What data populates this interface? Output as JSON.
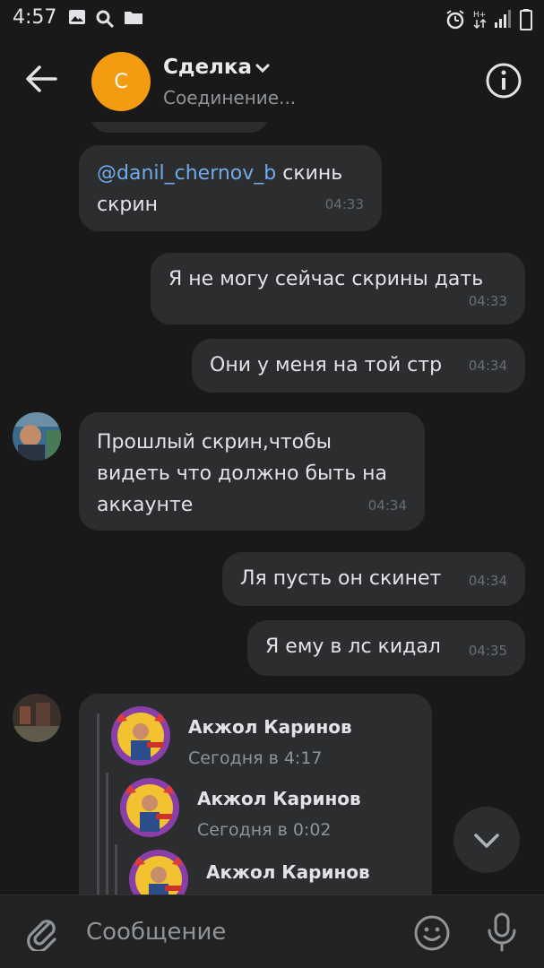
{
  "status_bar": {
    "time": "4:57",
    "left_icons": [
      "image-icon",
      "search-icon",
      "folder-icon"
    ],
    "right_icons": [
      "alarm-icon",
      "data-arrows-icon",
      "signal-icon",
      "battery-icon"
    ]
  },
  "header": {
    "avatar_letter": "С",
    "title": "Сделка",
    "subtitle": "Соединение..."
  },
  "messages": [
    {
      "side": "in",
      "mention": "@danil_chernov_b",
      "text": " скинь скрин",
      "time": "04:33"
    },
    {
      "side": "out",
      "text": "Я не могу сейчас скрины дать",
      "time": "04:33"
    },
    {
      "side": "out",
      "text": "Они у меня на той стр",
      "time": "04:34"
    },
    {
      "side": "in",
      "text": "Прошлый скрин,чтобы видеть что должно быть на аккаунте",
      "time": "04:34"
    },
    {
      "side": "out",
      "text": "Ля пусть он скинет",
      "time": "04:34"
    },
    {
      "side": "out",
      "text": "Я ему в лс кидал",
      "time": "04:35"
    }
  ],
  "forwarded": [
    {
      "name": "Акжол Каринов",
      "date": "Сегодня в 4:17"
    },
    {
      "name": "Акжол Каринов",
      "date": "Сегодня в 0:02"
    },
    {
      "name": "Акжол Каринов",
      "date": ""
    }
  ],
  "composer": {
    "placeholder": "Сообщение"
  },
  "colors": {
    "background": "#19191a",
    "bubble": "#2c2d2e",
    "avatar_orange": "#f39c12",
    "mention_blue": "#71aaeb"
  }
}
